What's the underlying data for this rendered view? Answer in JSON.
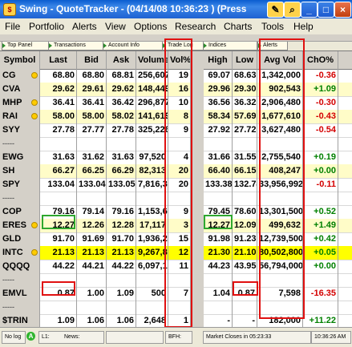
{
  "window": {
    "title": "Swing - QuoteTracker - (04/14/08 10:36:23 ) (Press",
    "buttons": [
      "_",
      "□",
      "×"
    ]
  },
  "menu": [
    "File",
    "Portfolio",
    "Alerts",
    "View",
    "Options",
    "Research",
    "Charts",
    "Tools",
    "Help"
  ],
  "tabs": [
    "Top Panel",
    "Transactions",
    "Account Info",
    "Trade Log",
    "Indices",
    "Alerts"
  ],
  "columns": [
    "Symbol",
    "Last",
    "Bid",
    "Ask",
    "Volume",
    "Vol%",
    "High",
    "Low",
    "Avg Vol",
    "ChO%"
  ],
  "rows": [
    {
      "symbol": "CG",
      "last": "68.80",
      "bid": "68.80",
      "ask": "68.81",
      "volume": "256,607",
      "volpct": "19",
      "high": "69.07",
      "low": "68.63",
      "avgvol": "1,342,000",
      "cho": "-0.36",
      "style": "white"
    },
    {
      "symbol": "CVA",
      "last": "29.62",
      "bid": "29.61",
      "ask": "29.62",
      "volume": "148,449",
      "volpct": "16",
      "high": "29.96",
      "low": "29.30",
      "avgvol": "902,543",
      "cho": "+1.09",
      "style": "yellow"
    },
    {
      "symbol": "MHP",
      "last": "36.41",
      "bid": "36.41",
      "ask": "36.42",
      "volume": "296,877",
      "volpct": "10",
      "high": "36.56",
      "low": "36.32",
      "avgvol": "2,906,480",
      "cho": "-0.30",
      "style": "white"
    },
    {
      "symbol": "RAI",
      "last": "58.00",
      "bid": "58.00",
      "ask": "58.02",
      "volume": "141,619",
      "volpct": "8",
      "high": "58.34",
      "low": "57.69",
      "avgvol": "1,677,610",
      "cho": "-0.43",
      "style": "yellow"
    },
    {
      "symbol": "SYY",
      "last": "27.78",
      "bid": "27.77",
      "ask": "27.78",
      "volume": "325,226",
      "volpct": "9",
      "high": "27.92",
      "low": "27.72",
      "avgvol": "3,627,480",
      "cho": "-0.54",
      "style": "white"
    },
    {
      "symbol": "-----",
      "sep": true
    },
    {
      "symbol": "EWG",
      "last": "31.63",
      "bid": "31.62",
      "ask": "31.63",
      "volume": "97,520",
      "volpct": "4",
      "high": "31.66",
      "low": "31.55",
      "avgvol": "2,755,540",
      "cho": "+0.19",
      "style": "white"
    },
    {
      "symbol": "SH",
      "last": "66.27",
      "bid": "66.25",
      "ask": "66.29",
      "volume": "82,313",
      "volpct": "20",
      "high": "66.40",
      "low": "66.15",
      "avgvol": "408,247",
      "cho": "+0.00",
      "style": "yellow"
    },
    {
      "symbol": "SPY",
      "last": "133.04",
      "bid": "133.04",
      "ask": "133.05",
      "volume": "7,816,356",
      "volpct": "20",
      "high": "133.38",
      "low": "132.74",
      "avgvol": "33,956,992",
      "cho": "-0.11",
      "style": "white"
    },
    {
      "symbol": "-----",
      "sep": true
    },
    {
      "symbol": "COP",
      "last": "79.16",
      "bid": "79.14",
      "ask": "79.16",
      "volume": "1,153,656",
      "volpct": "9",
      "high": "79.45",
      "low": "78.60",
      "avgvol": "13,301,500",
      "cho": "+0.52",
      "style": "white"
    },
    {
      "symbol": "ERES",
      "last": "12.27",
      "bid": "12.26",
      "ask": "12.28",
      "volume": "17,117",
      "volpct": "3",
      "high": "12.27",
      "low": "12.09",
      "avgvol": "499,632",
      "cho": "+1.49",
      "style": "yellow"
    },
    {
      "symbol": "GLD",
      "last": "91.70",
      "bid": "91.69",
      "ask": "91.70",
      "volume": "1,936,240",
      "volpct": "15",
      "high": "91.98",
      "low": "91.23",
      "avgvol": "12,739,500",
      "cho": "+0.42",
      "style": "white"
    },
    {
      "symbol": "INTC",
      "last": "21.13",
      "bid": "21.13",
      "ask": "21.13",
      "volume": "9,267,867",
      "volpct": "12",
      "high": "21.30",
      "low": "21.10",
      "avgvol": "80,502,800",
      "cho": "+0.05",
      "style": "highlight"
    },
    {
      "symbol": "QQQQ",
      "last": "44.22",
      "bid": "44.21",
      "ask": "44.22",
      "volume": "6,097,190",
      "volpct": "11",
      "high": "44.23",
      "low": "43.95",
      "avgvol": "56,794,000",
      "cho": "+0.00",
      "style": "white"
    },
    {
      "symbol": "-----",
      "sep": true
    },
    {
      "symbol": "EMVL",
      "last": "0.87",
      "bid": "1.00",
      "ask": "1.09",
      "volume": "500",
      "volpct": "7",
      "high": "1.04",
      "low": "0.87",
      "avgvol": "7,598",
      "cho": "-16.35",
      "style": "white"
    },
    {
      "symbol": "-----",
      "sep": true
    },
    {
      "symbol": "$TRIN",
      "last": "1.09",
      "bid": "1.06",
      "ask": "1.06",
      "volume": "2,648",
      "volpct": "1",
      "high": "-",
      "low": "-",
      "avgvol": "182,000",
      "cho": "+11.22",
      "style": "white"
    }
  ],
  "status": {
    "nolog": "No log",
    "a_badge": "A",
    "l1": "L1:",
    "news": "News:",
    "bfh": "BFH:",
    "market": "Market Closes in 05:23:33",
    "time": "10:36:26 AM"
  },
  "colors": {
    "positive": "#008000",
    "negative": "#d40000",
    "highlight": "#ffff00",
    "alt_row": "#fffcc8",
    "annotation": "#e01010"
  }
}
